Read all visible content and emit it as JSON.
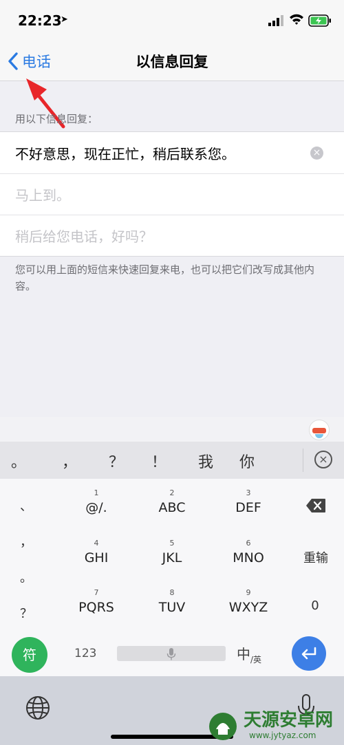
{
  "status_bar": {
    "time": "22:23",
    "location_icon": "location-arrow-icon"
  },
  "nav": {
    "back_label": "电话",
    "title": "以信息回复"
  },
  "section": {
    "header": "用以下信息回复："
  },
  "replies": [
    {
      "text": "不好意思，现在正忙，稍后联系您。",
      "placeholder": false
    },
    {
      "text": "马上到。",
      "placeholder": true
    },
    {
      "text": "稍后给您电话，好吗？",
      "placeholder": true
    }
  ],
  "footer": "您可以用上面的短信来快速回复来电，也可以把它们改写成其他内容。",
  "keyboard": {
    "candidates": [
      "。",
      "，",
      "？",
      "！",
      "我",
      "你"
    ],
    "punct": [
      "、",
      "，",
      "。",
      "？"
    ],
    "keys": [
      {
        "num": "1",
        "letters": "@/."
      },
      {
        "num": "2",
        "letters": "ABC"
      },
      {
        "num": "3",
        "letters": "DEF"
      },
      {
        "num": "4",
        "letters": "GHI"
      },
      {
        "num": "5",
        "letters": "JKL"
      },
      {
        "num": "6",
        "letters": "MNO"
      },
      {
        "num": "7",
        "letters": "PQRS"
      },
      {
        "num": "8",
        "letters": "TUV"
      },
      {
        "num": "9",
        "letters": "WXYZ"
      }
    ],
    "retype": "重输",
    "zero": "0",
    "symbol_key": "符",
    "num_key": "123",
    "lang_main": "中",
    "lang_sub": "/英"
  },
  "watermark": {
    "name": "天源安卓网",
    "url": "www.jytyaz.com"
  },
  "colors": {
    "accent": "#2a7ae2",
    "symbol_key": "#2fb45c",
    "enter_key": "#3d7fe6",
    "arrow": "#e8262a"
  }
}
